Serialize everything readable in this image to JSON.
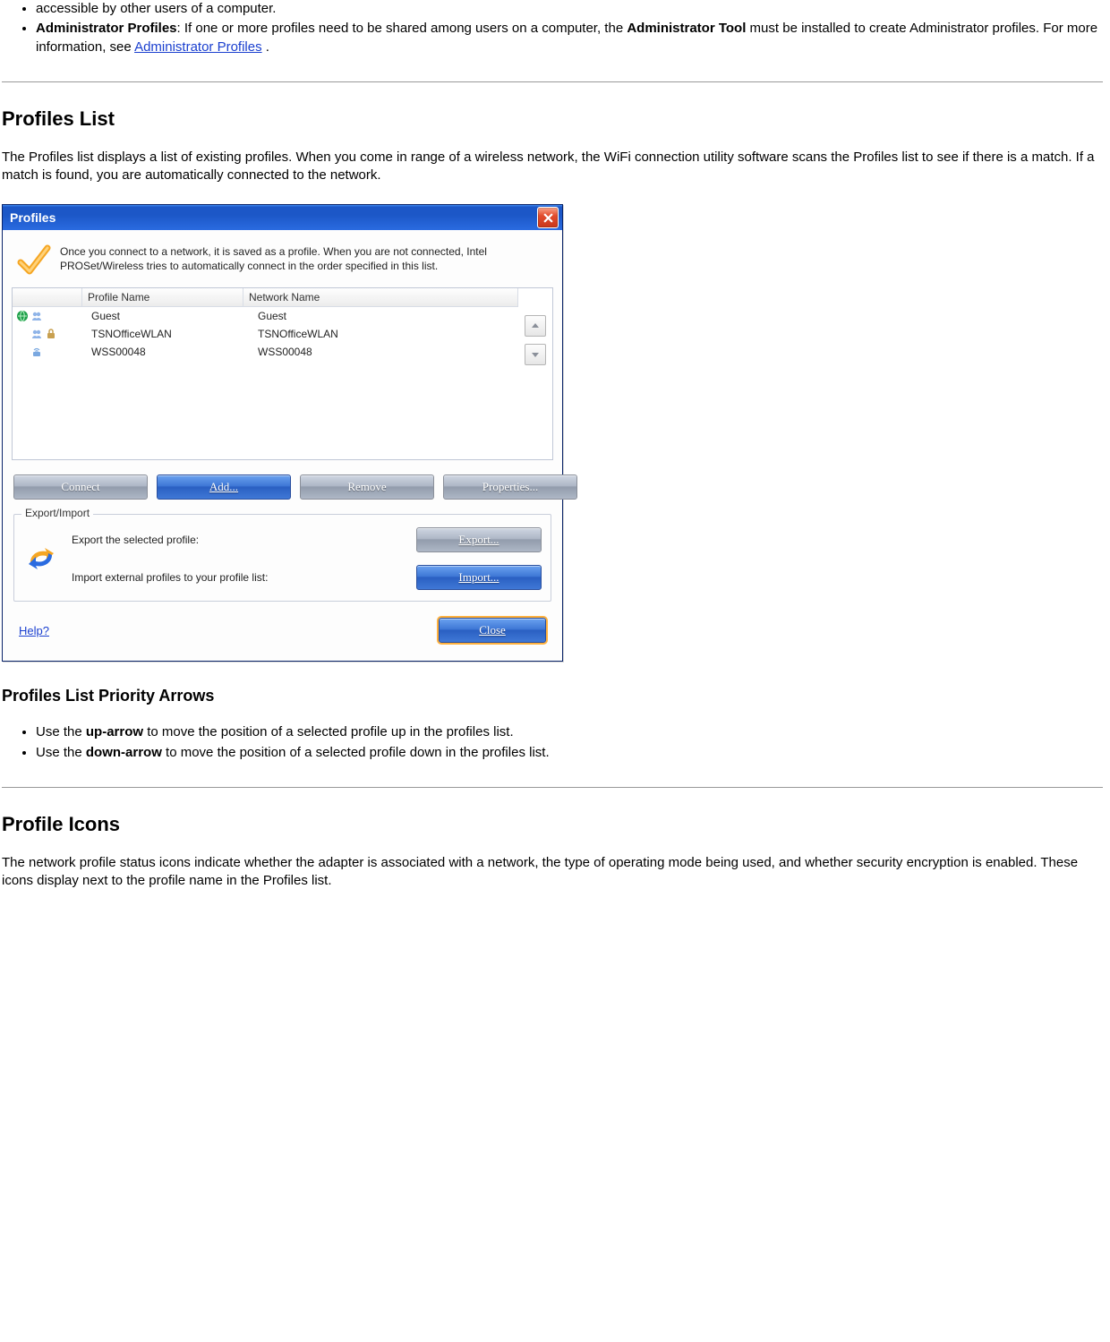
{
  "intro_bullets": {
    "b0_tail": "accessible by other users of a computer.",
    "b1_bold": "Administrator Profiles",
    "b1_text1": ": If one or more profiles need to be shared among users on a computer, the ",
    "b1_bold2": "Administrator Tool",
    "b1_text2": " must be installed to create Administrator profiles. For more information, see ",
    "b1_link": "Administrator Profiles",
    "b1_after": " ."
  },
  "sections": {
    "profiles_list_h": "Profiles List",
    "profiles_list_p": "The Profiles list displays a list of existing profiles. When you come in range of a wireless network, the WiFi connection utility software scans the Profiles list to see if there is a match. If a match is found, you are automatically connected to the network.",
    "priority_h": "Profiles List Priority Arrows",
    "priority_b1a": "Use the ",
    "priority_b1_bold": "up-arrow",
    "priority_b1b": " to move the position of a selected profile up in the profiles list.",
    "priority_b2a": "Use the ",
    "priority_b2_bold": "down-arrow",
    "priority_b2b": " to move the position of a selected profile down in the profiles list.",
    "icons_h": "Profile Icons",
    "icons_p": "The network profile status icons indicate whether the adapter is associated with a network, the type of operating mode being used, and whether security encryption is enabled. These icons display next to the profile name in the Profiles list."
  },
  "dialog": {
    "title": "Profiles",
    "intro": "Once you connect to a network, it is saved as a profile. When you are not connected, Intel PROSet/Wireless tries to automatically connect in the order specified in this list.",
    "headers": {
      "profile_name": "Profile Name",
      "network_name": "Network Name"
    },
    "rows": [
      {
        "profile": "Guest",
        "network": "Guest"
      },
      {
        "profile": "TSNOfficeWLAN",
        "network": "TSNOfficeWLAN"
      },
      {
        "profile": "WSS00048",
        "network": "WSS00048"
      }
    ],
    "buttons": {
      "connect": "Connect",
      "add": "Add...",
      "remove": "Remove",
      "properties": "Properties..."
    },
    "export_group": {
      "label": "Export/Import",
      "export_text": "Export the selected profile:",
      "import_text": "Import external profiles to your profile list:",
      "export_btn": "Export...",
      "import_btn": "Import..."
    },
    "help": "Help?",
    "close": "Close"
  }
}
